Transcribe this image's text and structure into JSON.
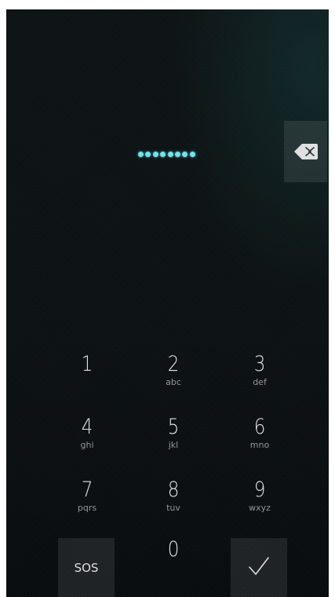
{
  "pin": {
    "entered_length": 8
  },
  "keypad": {
    "keys": [
      {
        "digit": "1",
        "letters": ""
      },
      {
        "digit": "2",
        "letters": "abc"
      },
      {
        "digit": "3",
        "letters": "def"
      },
      {
        "digit": "4",
        "letters": "ghi"
      },
      {
        "digit": "5",
        "letters": "jkl"
      },
      {
        "digit": "6",
        "letters": "mno"
      },
      {
        "digit": "7",
        "letters": "pqrs"
      },
      {
        "digit": "8",
        "letters": "tuv"
      },
      {
        "digit": "9",
        "letters": "wxyz"
      },
      {
        "digit": "0",
        "letters": ""
      }
    ],
    "sos_label": "SOS"
  },
  "icons": {
    "backspace": "backspace-icon",
    "accept": "checkmark-icon"
  },
  "colors": {
    "pin_dot": "#6fe3ea",
    "background": "#0b1012",
    "button_bg": "#1f2426"
  }
}
